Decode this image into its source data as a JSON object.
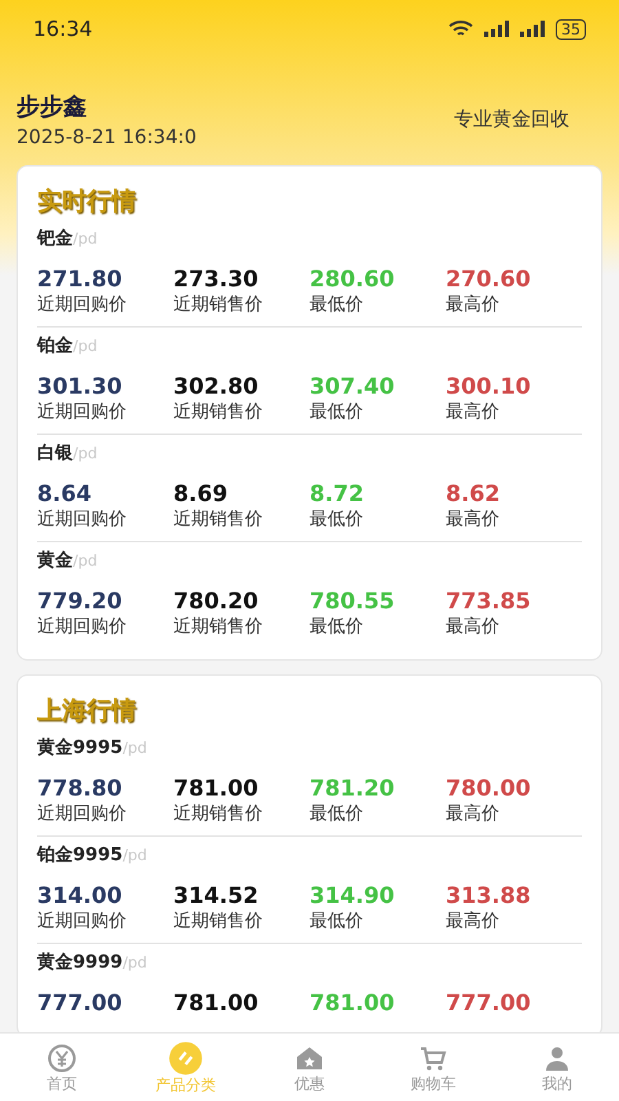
{
  "status_bar": {
    "time": "16:34",
    "battery": "35"
  },
  "header": {
    "brand": "步步鑫",
    "datetime": "2025-8-21 16:34:0",
    "slogan": "专业黄金回收"
  },
  "sections": [
    {
      "title": "实时行情",
      "items": [
        {
          "name": "钯金",
          "unit": "/pd",
          "cells": [
            {
              "kind": "buy",
              "value": "271.80",
              "label": "近期回购价"
            },
            {
              "kind": "sell",
              "value": "273.30",
              "label": "近期销售价"
            },
            {
              "kind": "low",
              "value": "280.60",
              "label": "最低价"
            },
            {
              "kind": "high",
              "value": "270.60",
              "label": "最高价"
            }
          ]
        },
        {
          "name": "铂金",
          "unit": "/pd",
          "cells": [
            {
              "kind": "buy",
              "value": "301.30",
              "label": "近期回购价"
            },
            {
              "kind": "sell",
              "value": "302.80",
              "label": "近期销售价"
            },
            {
              "kind": "low",
              "value": "307.40",
              "label": "最低价"
            },
            {
              "kind": "high",
              "value": "300.10",
              "label": "最高价"
            }
          ]
        },
        {
          "name": "白银",
          "unit": "/pd",
          "cells": [
            {
              "kind": "buy",
              "value": "8.64",
              "label": "近期回购价"
            },
            {
              "kind": "sell",
              "value": "8.69",
              "label": "近期销售价"
            },
            {
              "kind": "low",
              "value": "8.72",
              "label": "最低价"
            },
            {
              "kind": "high",
              "value": "8.62",
              "label": "最高价"
            }
          ]
        },
        {
          "name": "黄金",
          "unit": "/pd",
          "cells": [
            {
              "kind": "buy",
              "value": "779.20",
              "label": "近期回购价"
            },
            {
              "kind": "sell",
              "value": "780.20",
              "label": "近期销售价"
            },
            {
              "kind": "low",
              "value": "780.55",
              "label": "最低价"
            },
            {
              "kind": "high",
              "value": "773.85",
              "label": "最高价"
            }
          ]
        }
      ]
    },
    {
      "title": "上海行情",
      "items": [
        {
          "name": "黄金9995",
          "unit": "/pd",
          "cells": [
            {
              "kind": "buy",
              "value": "778.80",
              "label": "近期回购价"
            },
            {
              "kind": "sell",
              "value": "781.00",
              "label": "近期销售价"
            },
            {
              "kind": "low",
              "value": "781.20",
              "label": "最低价"
            },
            {
              "kind": "high",
              "value": "780.00",
              "label": "最高价"
            }
          ]
        },
        {
          "name": "铂金9995",
          "unit": "/pd",
          "cells": [
            {
              "kind": "buy",
              "value": "314.00",
              "label": "近期回购价"
            },
            {
              "kind": "sell",
              "value": "314.52",
              "label": "近期销售价"
            },
            {
              "kind": "low",
              "value": "314.90",
              "label": "最低价"
            },
            {
              "kind": "high",
              "value": "313.88",
              "label": "最高价"
            }
          ]
        },
        {
          "name": "黄金9999",
          "unit": "/pd",
          "cells": [
            {
              "kind": "buy",
              "value": "777.00"
            },
            {
              "kind": "sell",
              "value": "781.00"
            },
            {
              "kind": "low",
              "value": "781.00"
            },
            {
              "kind": "high",
              "value": "777.00"
            }
          ]
        }
      ]
    }
  ],
  "tab_bar": [
    {
      "kind": "yen",
      "label": "首页",
      "selected": false
    },
    {
      "kind": "category",
      "label": "产品分类",
      "selected": true
    },
    {
      "kind": "discount",
      "label": "优惠",
      "selected": false
    },
    {
      "kind": "cart",
      "label": "购物车",
      "selected": false
    },
    {
      "kind": "user",
      "label": "我的",
      "selected": false
    }
  ]
}
